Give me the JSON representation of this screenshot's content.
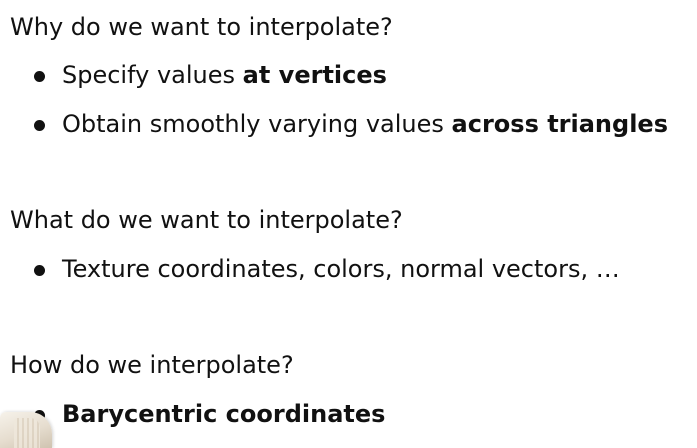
{
  "sections": [
    {
      "heading": "Why do we want to interpolate?",
      "bullets": [
        {
          "text": "Specify values ",
          "bold": "at vertices"
        },
        {
          "text": "Obtain smoothly varying values ",
          "bold": "across triangles"
        }
      ]
    },
    {
      "heading": "What do we want to interpolate?",
      "bullets": [
        {
          "text": "Texture coordinates, colors, normal vectors, …",
          "bold": ""
        }
      ]
    },
    {
      "heading": "How do we interpolate?",
      "bullets": [
        {
          "text": "",
          "bold": "Barycentric coordinates"
        }
      ]
    }
  ]
}
